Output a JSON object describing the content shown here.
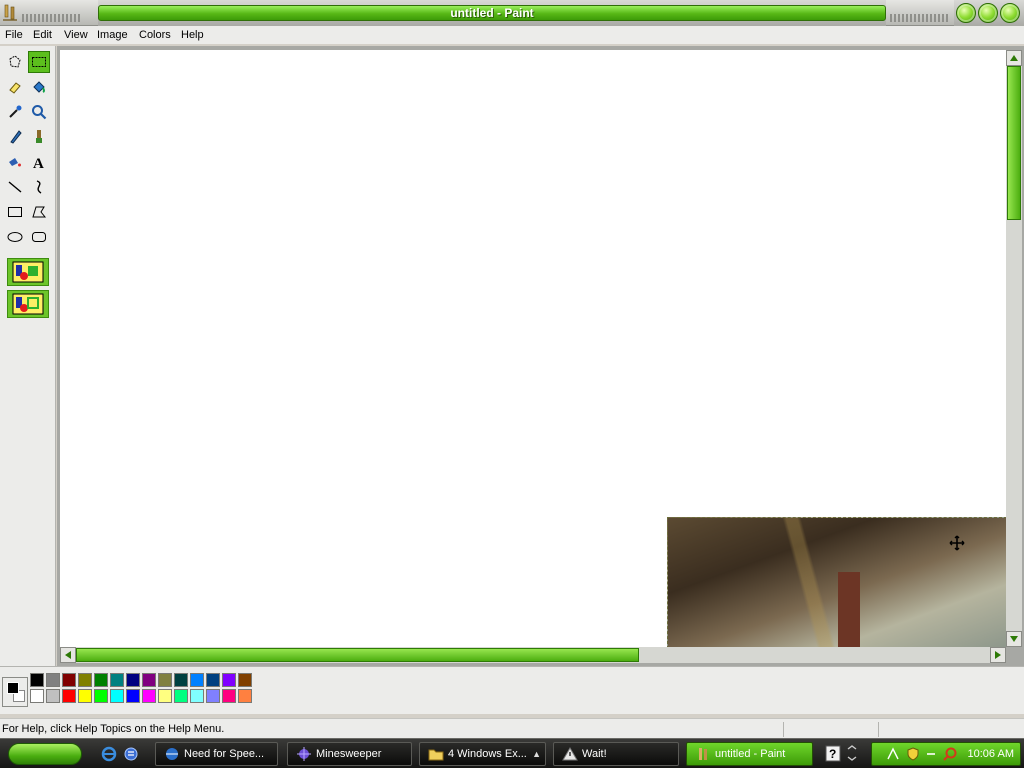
{
  "window": {
    "title": "untitled - Paint"
  },
  "menu": {
    "items": [
      "File",
      "Edit",
      "View",
      "Image",
      "Colors",
      "Help"
    ]
  },
  "tools": [
    {
      "name": "free-form-select",
      "icon": "free-form-select-icon"
    },
    {
      "name": "select",
      "icon": "rectangle-select-icon",
      "active": true
    },
    {
      "name": "eraser",
      "icon": "eraser-icon"
    },
    {
      "name": "fill-with-color",
      "icon": "paint-bucket-icon"
    },
    {
      "name": "pick-color",
      "icon": "eyedropper-icon"
    },
    {
      "name": "magnifier",
      "icon": "magnifier-icon"
    },
    {
      "name": "pencil",
      "icon": "pencil-icon"
    },
    {
      "name": "brush",
      "icon": "brush-icon"
    },
    {
      "name": "airbrush",
      "icon": "airbrush-icon"
    },
    {
      "name": "text",
      "icon": "text-icon",
      "label": "A"
    },
    {
      "name": "line",
      "icon": "line-icon"
    },
    {
      "name": "curve",
      "icon": "curve-icon"
    },
    {
      "name": "rectangle",
      "icon": "rectangle-icon"
    },
    {
      "name": "polygon",
      "icon": "polygon-icon"
    },
    {
      "name": "ellipse",
      "icon": "ellipse-icon"
    },
    {
      "name": "rounded-rectangle",
      "icon": "rounded-rectangle-icon"
    }
  ],
  "tool_options": [
    {
      "name": "opaque-selection",
      "icon": "opaque-selection-icon"
    },
    {
      "name": "transparent-selection",
      "icon": "transparent-selection-icon"
    }
  ],
  "colors": {
    "foreground": "#000000",
    "background": "#ffffff",
    "accent": "#4cae10",
    "palette_top": [
      "#000000",
      "#808080",
      "#800000",
      "#808000",
      "#008000",
      "#008080",
      "#000080",
      "#800080",
      "#808040",
      "#004040",
      "#0080ff",
      "#004080",
      "#8000ff",
      "#804000"
    ],
    "palette_bottom": [
      "#ffffff",
      "#c0c0c0",
      "#ff0000",
      "#ffff00",
      "#00ff00",
      "#00ffff",
      "#0000ff",
      "#ff00ff",
      "#ffff80",
      "#00ff80",
      "#80ffff",
      "#8080ff",
      "#ff0080",
      "#ff8040"
    ]
  },
  "status": {
    "help_text": "For Help, click Help Topics on the Help Menu."
  },
  "taskbar": {
    "buttons": [
      {
        "label": "Need for Spee...",
        "icon": "browser-icon"
      },
      {
        "label": "Minesweeper",
        "icon": "minesweeper-icon"
      },
      {
        "label": "4 Windows Ex...",
        "icon": "folder-icon"
      },
      {
        "label": "Wait!",
        "icon": "alert-icon"
      },
      {
        "label": "untitled - Paint",
        "icon": "paint-icon",
        "active": true
      }
    ],
    "clock": "10:06 AM"
  }
}
